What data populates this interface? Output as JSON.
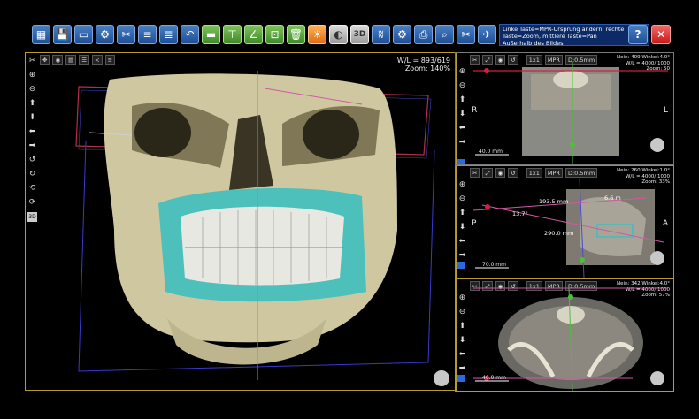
{
  "toolbar": {
    "icons": [
      "load-icon",
      "save-icon",
      "comment-icon",
      "settings-icon",
      "tools-icon",
      "implant-icon",
      "align-icon",
      "undo-icon",
      "ruler-icon",
      "panorama-icon",
      "angle-icon",
      "crop-icon",
      "delete-icon",
      "brightness-icon",
      "contrast-icon",
      "3d-icon",
      "teeth-icon",
      "export-icon",
      "print-icon",
      "search-icon",
      "cut-icon",
      "airplane-icon"
    ],
    "btn_3d": "3D",
    "hint_line1": "Linke Taste=MPR-Ursprung ändern, rechte",
    "hint_line2": "Taste=Zoom, mittlere Taste=Pan",
    "hint_line3": "Außerhalb des Bildes",
    "help": "?",
    "close": "✕"
  },
  "main_view": {
    "wl": "W/L = 893/619",
    "zoom": "Zoom: 140%",
    "tool_3d": "3D"
  },
  "views": [
    {
      "btn_1x1": "1x1",
      "btn_mpr": "MPR",
      "btn_d": "D:0.5mm",
      "info1": "Nein: 409 Winkel:4.0°",
      "info2": "W/L = 4000/ 1000",
      "info3": "Zoom: 50",
      "left": "R",
      "right": "L",
      "scale": "40.0 mm"
    },
    {
      "btn_1x1": "1x1",
      "btn_mpr": "MPR",
      "btn_d": "D:0.5mm",
      "info1": "Nein: 260 Winkel:1.0°",
      "info2": "W/L = 4000/ 1000",
      "info3": "Zoom: 33%",
      "left": "P",
      "right": "A",
      "scale": "70.0 mm",
      "m1": "193.5 mm",
      "m2": "6.6 m",
      "m3": "13.7°",
      "m4": "290.0 mm"
    },
    {
      "btn_1x1": "1x1",
      "btn_mpr": "MPR",
      "btn_d": "D:0.5mm",
      "info1": "Nein: 342 Winkel:4.0°",
      "info2": "W/L = 4000/ 1000",
      "info3": "Zoom: 57%",
      "left": "",
      "right": "",
      "scale": "40.0 mm"
    }
  ],
  "colors": {
    "frame": "#b89b2c",
    "toolbar_blue": "#1d4f95",
    "cyan": "#3fbfbf",
    "bone": "#cfc7a0"
  }
}
